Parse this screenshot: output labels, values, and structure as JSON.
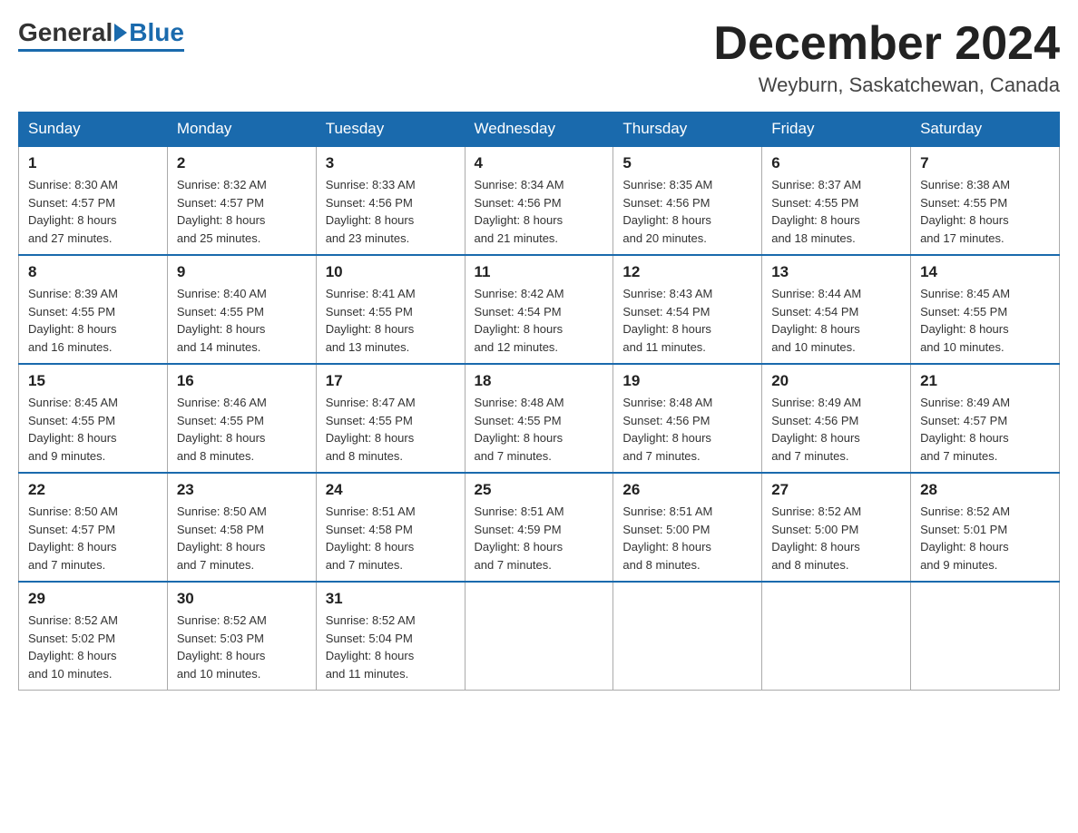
{
  "header": {
    "logo_general": "General",
    "logo_blue": "Blue",
    "month_title": "December 2024",
    "location": "Weyburn, Saskatchewan, Canada"
  },
  "days_of_week": [
    "Sunday",
    "Monday",
    "Tuesday",
    "Wednesday",
    "Thursday",
    "Friday",
    "Saturday"
  ],
  "weeks": [
    [
      {
        "day": "1",
        "sunrise": "8:30 AM",
        "sunset": "4:57 PM",
        "daylight": "8 hours and 27 minutes."
      },
      {
        "day": "2",
        "sunrise": "8:32 AM",
        "sunset": "4:57 PM",
        "daylight": "8 hours and 25 minutes."
      },
      {
        "day": "3",
        "sunrise": "8:33 AM",
        "sunset": "4:56 PM",
        "daylight": "8 hours and 23 minutes."
      },
      {
        "day": "4",
        "sunrise": "8:34 AM",
        "sunset": "4:56 PM",
        "daylight": "8 hours and 21 minutes."
      },
      {
        "day": "5",
        "sunrise": "8:35 AM",
        "sunset": "4:56 PM",
        "daylight": "8 hours and 20 minutes."
      },
      {
        "day": "6",
        "sunrise": "8:37 AM",
        "sunset": "4:55 PM",
        "daylight": "8 hours and 18 minutes."
      },
      {
        "day": "7",
        "sunrise": "8:38 AM",
        "sunset": "4:55 PM",
        "daylight": "8 hours and 17 minutes."
      }
    ],
    [
      {
        "day": "8",
        "sunrise": "8:39 AM",
        "sunset": "4:55 PM",
        "daylight": "8 hours and 16 minutes."
      },
      {
        "day": "9",
        "sunrise": "8:40 AM",
        "sunset": "4:55 PM",
        "daylight": "8 hours and 14 minutes."
      },
      {
        "day": "10",
        "sunrise": "8:41 AM",
        "sunset": "4:55 PM",
        "daylight": "8 hours and 13 minutes."
      },
      {
        "day": "11",
        "sunrise": "8:42 AM",
        "sunset": "4:54 PM",
        "daylight": "8 hours and 12 minutes."
      },
      {
        "day": "12",
        "sunrise": "8:43 AM",
        "sunset": "4:54 PM",
        "daylight": "8 hours and 11 minutes."
      },
      {
        "day": "13",
        "sunrise": "8:44 AM",
        "sunset": "4:54 PM",
        "daylight": "8 hours and 10 minutes."
      },
      {
        "day": "14",
        "sunrise": "8:45 AM",
        "sunset": "4:55 PM",
        "daylight": "8 hours and 10 minutes."
      }
    ],
    [
      {
        "day": "15",
        "sunrise": "8:45 AM",
        "sunset": "4:55 PM",
        "daylight": "8 hours and 9 minutes."
      },
      {
        "day": "16",
        "sunrise": "8:46 AM",
        "sunset": "4:55 PM",
        "daylight": "8 hours and 8 minutes."
      },
      {
        "day": "17",
        "sunrise": "8:47 AM",
        "sunset": "4:55 PM",
        "daylight": "8 hours and 8 minutes."
      },
      {
        "day": "18",
        "sunrise": "8:48 AM",
        "sunset": "4:55 PM",
        "daylight": "8 hours and 7 minutes."
      },
      {
        "day": "19",
        "sunrise": "8:48 AM",
        "sunset": "4:56 PM",
        "daylight": "8 hours and 7 minutes."
      },
      {
        "day": "20",
        "sunrise": "8:49 AM",
        "sunset": "4:56 PM",
        "daylight": "8 hours and 7 minutes."
      },
      {
        "day": "21",
        "sunrise": "8:49 AM",
        "sunset": "4:57 PM",
        "daylight": "8 hours and 7 minutes."
      }
    ],
    [
      {
        "day": "22",
        "sunrise": "8:50 AM",
        "sunset": "4:57 PM",
        "daylight": "8 hours and 7 minutes."
      },
      {
        "day": "23",
        "sunrise": "8:50 AM",
        "sunset": "4:58 PM",
        "daylight": "8 hours and 7 minutes."
      },
      {
        "day": "24",
        "sunrise": "8:51 AM",
        "sunset": "4:58 PM",
        "daylight": "8 hours and 7 minutes."
      },
      {
        "day": "25",
        "sunrise": "8:51 AM",
        "sunset": "4:59 PM",
        "daylight": "8 hours and 7 minutes."
      },
      {
        "day": "26",
        "sunrise": "8:51 AM",
        "sunset": "5:00 PM",
        "daylight": "8 hours and 8 minutes."
      },
      {
        "day": "27",
        "sunrise": "8:52 AM",
        "sunset": "5:00 PM",
        "daylight": "8 hours and 8 minutes."
      },
      {
        "day": "28",
        "sunrise": "8:52 AM",
        "sunset": "5:01 PM",
        "daylight": "8 hours and 9 minutes."
      }
    ],
    [
      {
        "day": "29",
        "sunrise": "8:52 AM",
        "sunset": "5:02 PM",
        "daylight": "8 hours and 10 minutes."
      },
      {
        "day": "30",
        "sunrise": "8:52 AM",
        "sunset": "5:03 PM",
        "daylight": "8 hours and 10 minutes."
      },
      {
        "day": "31",
        "sunrise": "8:52 AM",
        "sunset": "5:04 PM",
        "daylight": "8 hours and 11 minutes."
      },
      null,
      null,
      null,
      null
    ]
  ],
  "labels": {
    "sunrise": "Sunrise:",
    "sunset": "Sunset:",
    "daylight": "Daylight:"
  }
}
